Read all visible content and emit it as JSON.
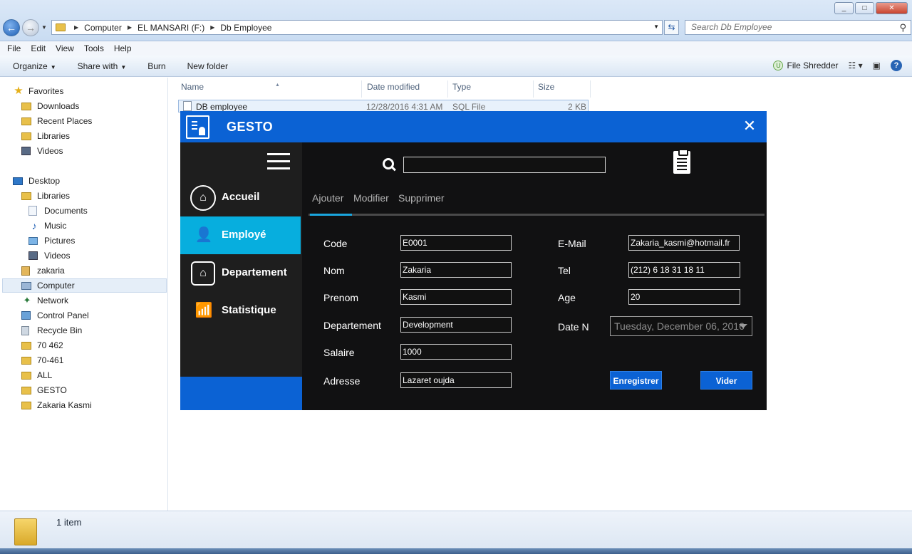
{
  "window": {
    "controls": [
      "_",
      "□",
      "✕"
    ]
  },
  "address": {
    "crumbs": [
      "Computer",
      "EL MANSARI (F:)",
      "Db Employee"
    ]
  },
  "search": {
    "placeholder": "Search Db Employee"
  },
  "menu": [
    "File",
    "Edit",
    "View",
    "Tools",
    "Help"
  ],
  "toolbar": {
    "organize": "Organize",
    "share_with": "Share with",
    "burn": "Burn",
    "new_folder": "New folder",
    "file_shredder": "File Shredder"
  },
  "nav": {
    "favorites": "Favorites",
    "downloads": "Downloads",
    "recent_places": "Recent Places",
    "libraries_fav": "Libraries",
    "videos_fav": "Videos",
    "desktop": "Desktop",
    "libraries": "Libraries",
    "documents": "Documents",
    "music": "Music",
    "pictures": "Pictures",
    "videos": "Videos",
    "zakaria": "zakaria",
    "computer": "Computer",
    "network": "Network",
    "control_panel": "Control Panel",
    "recycle_bin": "Recycle Bin",
    "f70462": "70 462",
    "f70461": "70-461",
    "all": "ALL",
    "gesto": "GESTO",
    "zakaria_kasmi": "Zakaria Kasmi"
  },
  "columns": {
    "name": "Name",
    "date_modified": "Date modified",
    "type": "Type",
    "size": "Size"
  },
  "file": {
    "name": "DB employee",
    "date": "12/28/2016 4:31 AM",
    "type": "SQL File",
    "size": "2 KB"
  },
  "status": {
    "count": "1 item"
  },
  "app": {
    "title": "GESTO",
    "close": "✕",
    "sidebar": {
      "accueil": "Accueil",
      "employe": "Employé",
      "departement": "Departement",
      "statistique": "Statistique"
    },
    "tabs": {
      "ajouter": "Ajouter",
      "modifier": "Modifier",
      "supprimer": "Supprimer"
    },
    "labels": {
      "code": "Code",
      "nom": "Nom",
      "prenom": "Prenom",
      "departement": "Departement",
      "salaire": "Salaire",
      "adresse": "Adresse",
      "email": "E-Mail",
      "tel": "Tel",
      "age": "Age",
      "date_n": "Date N"
    },
    "values": {
      "code": "E0001",
      "nom": "Zakaria",
      "prenom": "Kasmi",
      "departement": "Development",
      "salaire": "1000",
      "adresse": "Lazaret oujda",
      "email": "Zakaria_kasmi@hotmail.fr",
      "tel": "(212) 6 18 31 18 11",
      "age": "20",
      "date_n": "Tuesday, December 06, 2016"
    },
    "buttons": {
      "enregistrer": "Enregistrer",
      "vider": "Vider"
    }
  }
}
